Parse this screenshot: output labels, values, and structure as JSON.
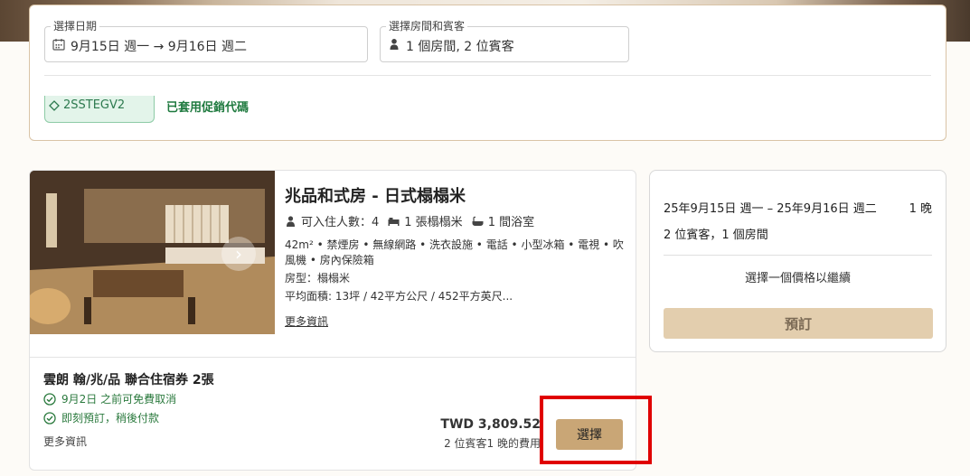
{
  "search": {
    "dates": {
      "label": "選擇日期",
      "value": "9月15日 週一 → 9月16日 週二",
      "icon": "calendar-icon"
    },
    "rooms_guests": {
      "label": "選擇房間和賓客",
      "value": "1 個房間, 2 位賓客",
      "icon": "person-icon"
    },
    "promo": {
      "code": "2SSTEGV2",
      "applied_text": "已套用促銷代碼"
    }
  },
  "room": {
    "title": "兆品和式房 - 日式榻榻米",
    "specs": [
      {
        "icon": "person-icon",
        "text": "可入住人數：4"
      },
      {
        "icon": "bed-icon",
        "text": "1 張榻榻米"
      },
      {
        "icon": "bathtub-icon",
        "text": "1 間浴室"
      }
    ],
    "amenities": [
      "42m²",
      "禁煙房",
      "無線網路",
      "洗衣設施",
      "電話",
      "小型冰箱",
      "電視",
      "吹風機",
      "房內保險箱"
    ],
    "room_type": "房型：榻榻米",
    "area": "平均面積: 13坪 / 42平方公尺 / 452平方英尺...",
    "more_info": "更多資訊"
  },
  "rate": {
    "name": "雲朗 翰/兆/品 聯合住宿券 2張",
    "features": [
      {
        "icon": "check-circle-icon",
        "text": "9月2日 之前可免費取消"
      },
      {
        "icon": "check-circle-icon",
        "text": "即刻預訂，稍後付款"
      }
    ],
    "more_info": "更多資訊",
    "price": "TWD 3,809.52",
    "price_note": "2 位賓客1 晚的費用",
    "select_label": "選擇"
  },
  "summary": {
    "dates": "25年9月15日 週一 – 25年9月16日 週二",
    "nights": "1 晚",
    "guests_rooms": "2 位賓客，1 個房間",
    "prompt": "選擇一個價格以繼續",
    "book_label": "預訂"
  },
  "colors": {
    "accent": "#c9a676",
    "book_disabled": "#e3ceae",
    "success_green": "#1f7a3f",
    "highlight_red": "#e00000",
    "panel_border": "#d9c3a6"
  }
}
